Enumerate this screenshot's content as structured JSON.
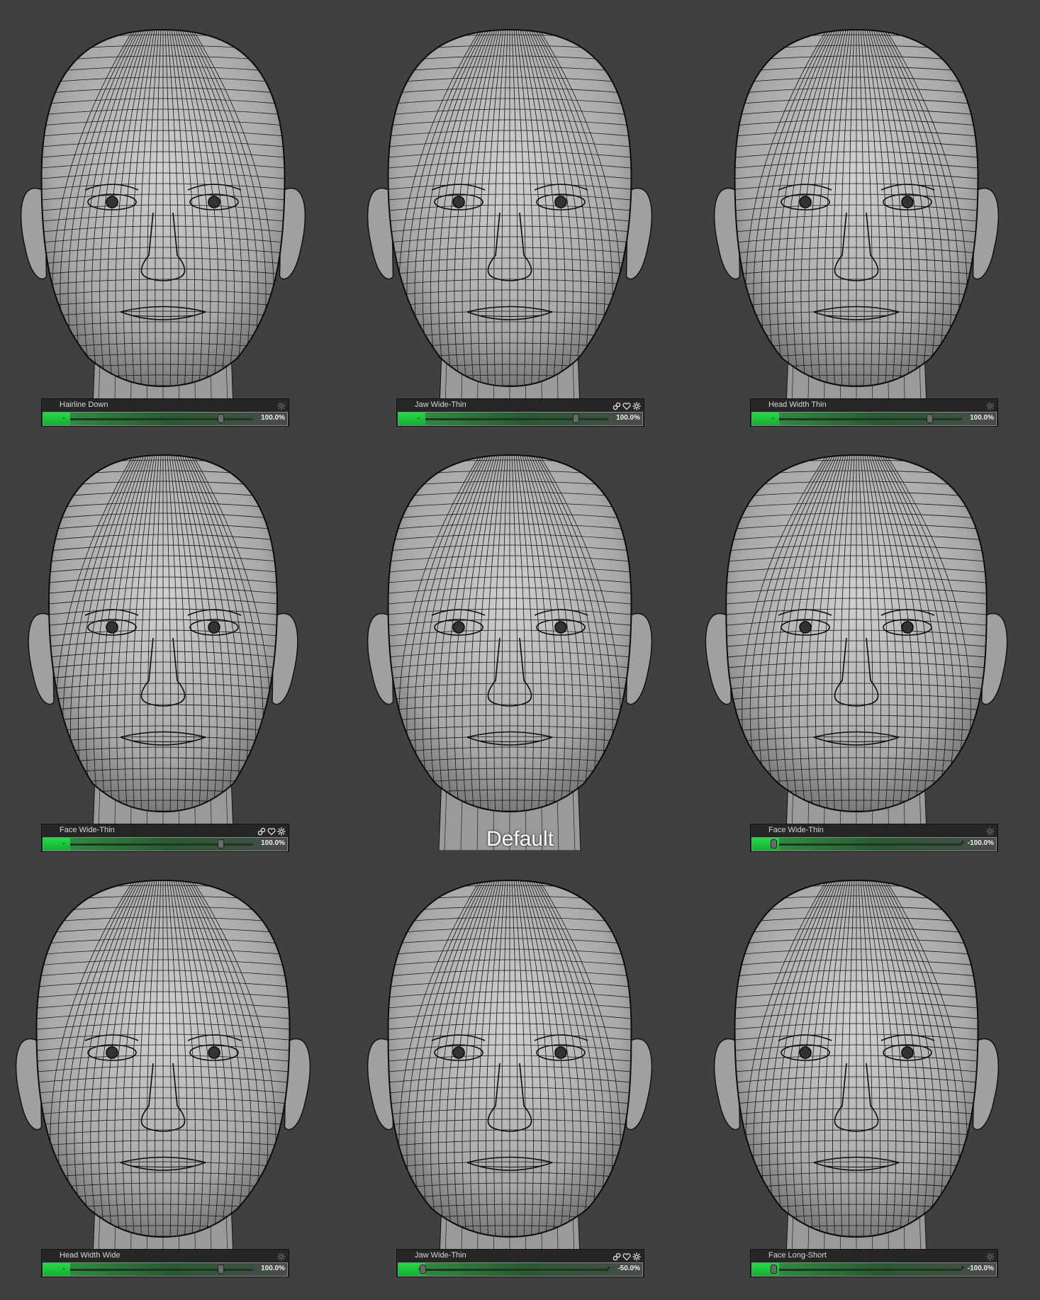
{
  "panels": [
    {
      "label": "Hairline Down",
      "value": "100.0%",
      "level": 1.0,
      "show_icons": false
    },
    {
      "label": "Jaw Wide-Thin",
      "value": "100.0%",
      "level": 1.0,
      "show_icons": true
    },
    {
      "label": "Head Width Thin",
      "value": "100.0%",
      "level": 1.0,
      "show_icons": false
    },
    {
      "label": "Face Wide-Thin",
      "value": "100.0%",
      "level": 1.0,
      "show_icons": true
    },
    {
      "label": "Default",
      "is_default": true
    },
    {
      "label": "Face Wide-Thin",
      "value": "-100.0%",
      "level": -1.0,
      "show_icons": false
    },
    {
      "label": "Head Width Wide",
      "value": "100.0%",
      "level": 1.0,
      "show_icons": false
    },
    {
      "label": "Jaw Wide-Thin",
      "value": "-50.0%",
      "level": -0.5,
      "show_icons": true
    },
    {
      "label": "Face Long-Short",
      "value": "-100.0%",
      "level": -1.0,
      "show_icons": false
    }
  ],
  "icons": [
    "link-icon",
    "heart-icon",
    "gear-icon"
  ],
  "colors": {
    "background": "#404040",
    "slider_green": "#20c83c",
    "wire": "#111111",
    "skin": "#b8b8b8"
  }
}
